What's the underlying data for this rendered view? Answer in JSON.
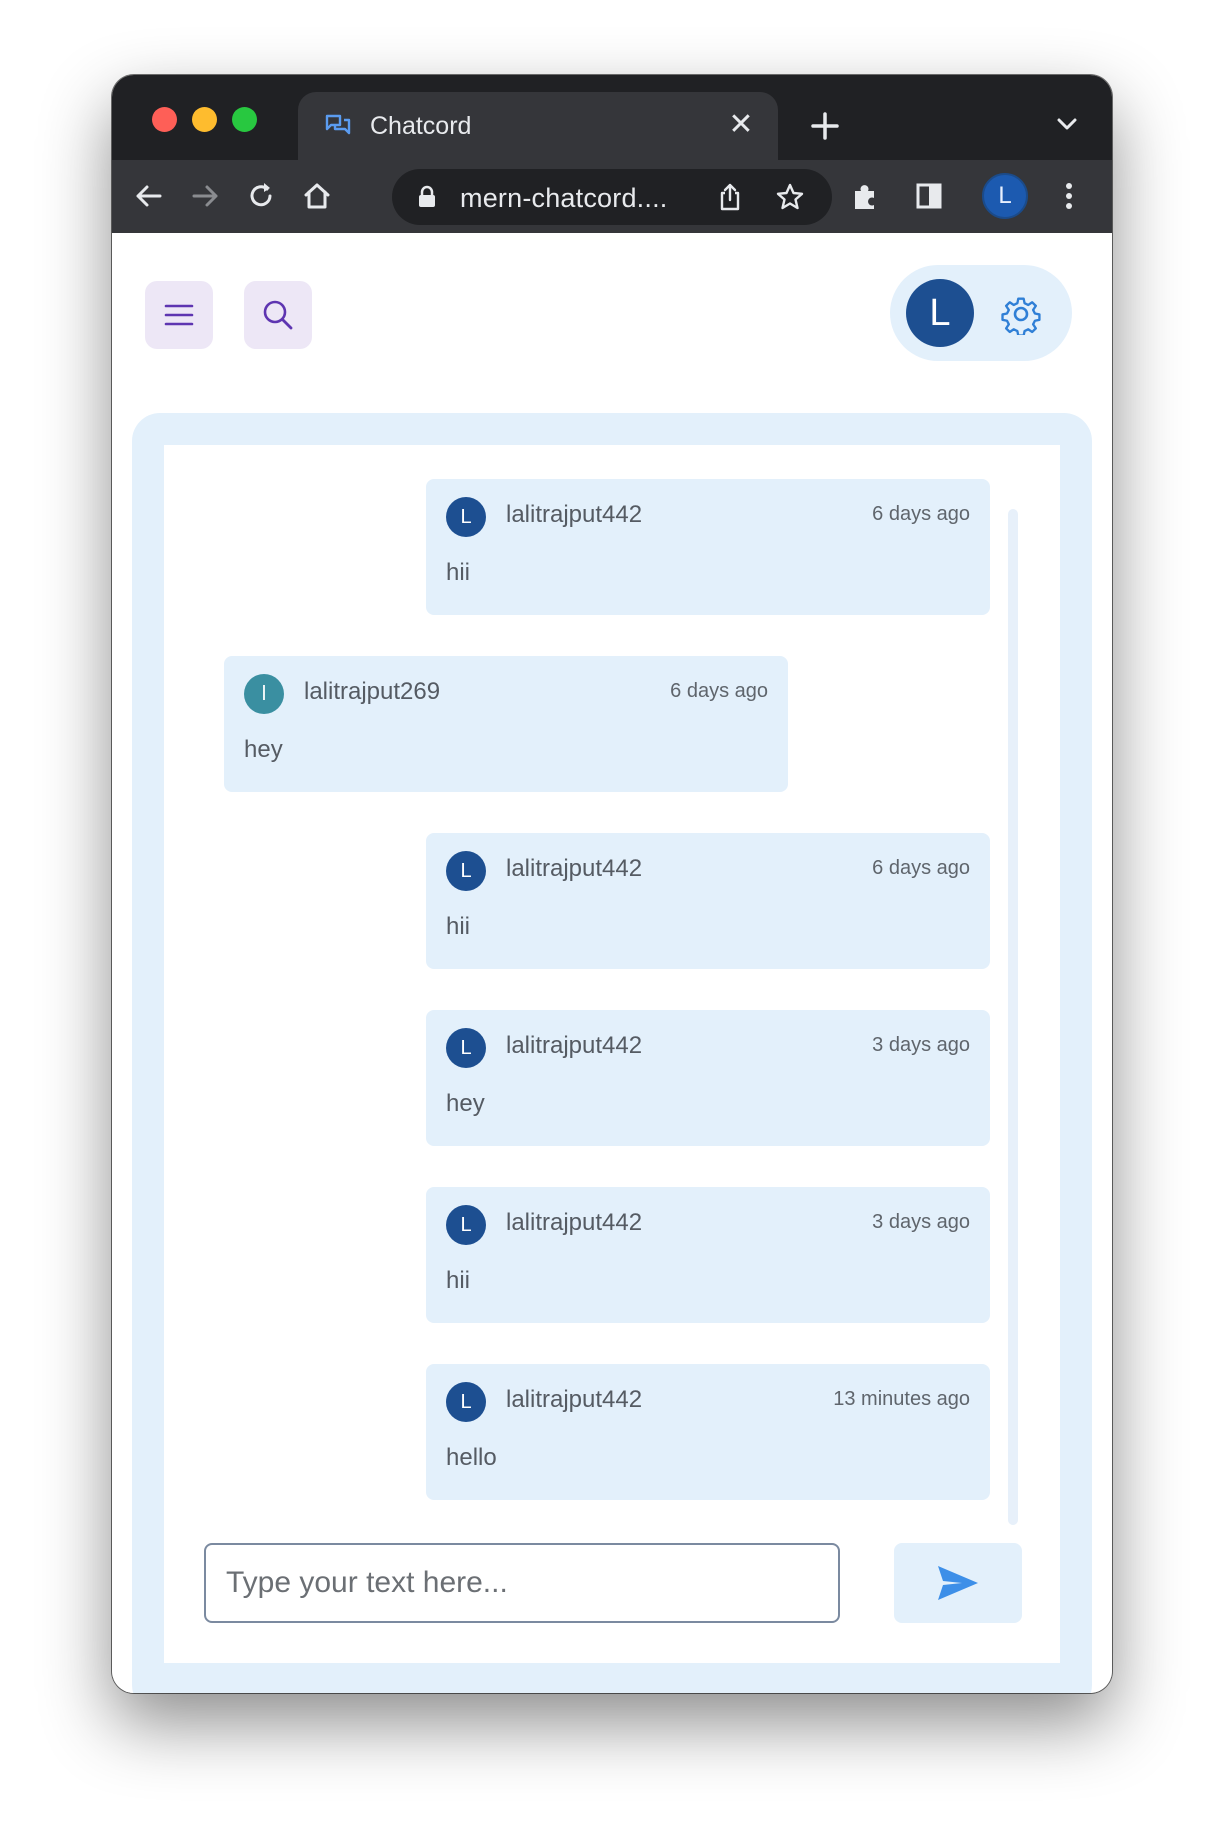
{
  "browser": {
    "tab_title": "Chatcord",
    "tab_close": "✕",
    "url": "mern-chatcord....",
    "profile_initial": "L"
  },
  "header": {
    "user_initial": "L"
  },
  "messages": [
    {
      "initial": "L",
      "user": "lalitrajput442",
      "time": "6 days ago",
      "text": "hii",
      "side": "mine"
    },
    {
      "initial": "l",
      "user": "lalitrajput269",
      "time": "6 days ago",
      "text": "hey",
      "side": "theirs"
    },
    {
      "initial": "L",
      "user": "lalitrajput442",
      "time": "6 days ago",
      "text": "hii",
      "side": "mine"
    },
    {
      "initial": "L",
      "user": "lalitrajput442",
      "time": "3 days ago",
      "text": "hey",
      "side": "mine"
    },
    {
      "initial": "L",
      "user": "lalitrajput442",
      "time": "3 days ago",
      "text": "hii",
      "side": "mine"
    },
    {
      "initial": "L",
      "user": "lalitrajput442",
      "time": "13 minutes ago",
      "text": "hello",
      "side": "mine"
    }
  ],
  "composer": {
    "placeholder": "Type your text here..."
  },
  "colors": {
    "accent": "#1d4f91",
    "bubble": "#e3f0fb",
    "other_avatar": "#3a8fa1"
  }
}
